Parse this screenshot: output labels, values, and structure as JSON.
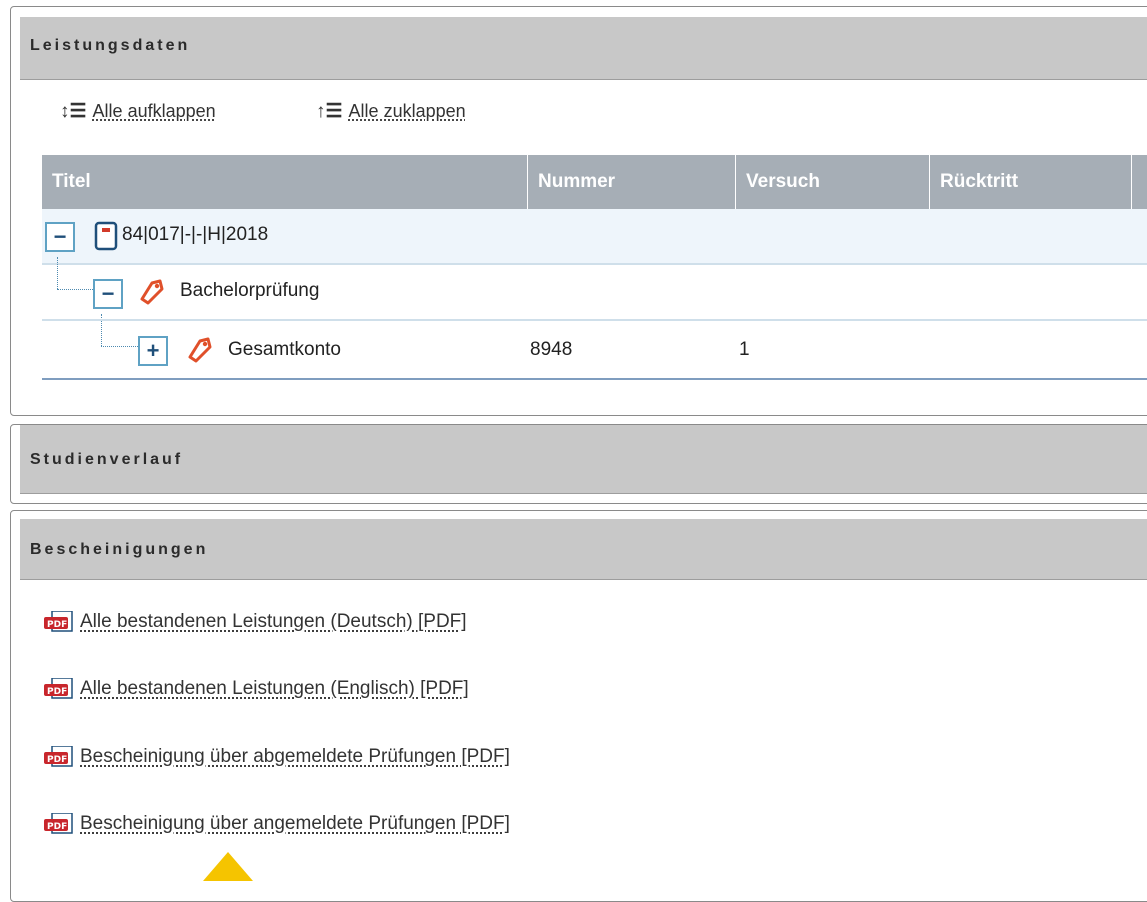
{
  "leistungsdaten": {
    "title": "Leistungsdaten",
    "expand_all": "Alle aufklappen",
    "collapse_all": "Alle zuklappen",
    "columns": [
      "Titel",
      "Nummer",
      "Versuch",
      "Rücktritt"
    ],
    "rows": [
      {
        "toggle": "−",
        "icon": "document-icon",
        "title": "84|017|-|-|H|2018",
        "nummer": "",
        "versuch": ""
      },
      {
        "toggle": "−",
        "icon": "tag-icon",
        "title": "Bachelorprüfung",
        "nummer": "",
        "versuch": ""
      },
      {
        "toggle": "+",
        "icon": "tag-icon",
        "title": "Gesamtkonto",
        "nummer": "8948",
        "versuch": "1"
      }
    ]
  },
  "studienverlauf": {
    "title": "Studienverlauf"
  },
  "bescheinigungen": {
    "title": "Bescheinigungen",
    "links": [
      "Alle bestandenen Leistungen (Deutsch) [PDF]",
      "Alle bestandenen Leistungen (Englisch) [PDF]",
      "Bescheinigung über abgemeldete Prüfungen [PDF]",
      "Bescheinigung über angemeldete Prüfungen [PDF]"
    ]
  },
  "colors": {
    "header_gray": "#c8c8c8",
    "table_header": "#a6aeb6",
    "toggle_border": "#5fa2c4",
    "pdf_red": "#c8262c",
    "tag_orange": "#e0502a",
    "warning_yellow": "#f5c400"
  }
}
